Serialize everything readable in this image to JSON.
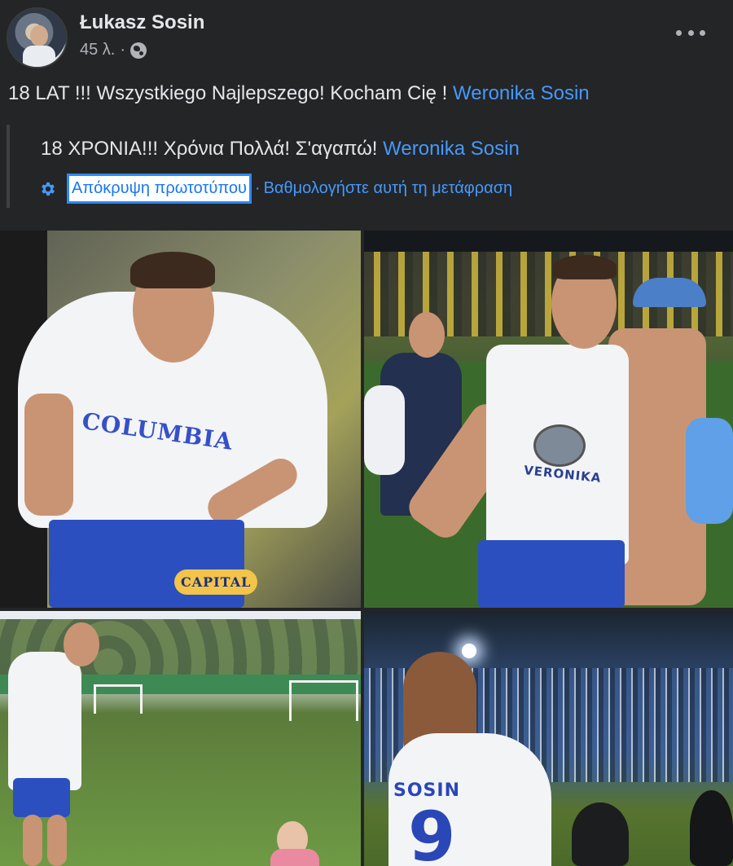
{
  "post": {
    "author": "Łukasz Sosin",
    "time": "45 λ.",
    "separator": "·",
    "message_text": "18 LAT !!! Wszystkiego Najlepszego! Kocham Cię !",
    "message_mention": "Weronika Sosin",
    "translation": {
      "text": "18 ΧΡΟΝΙΑ!!! Χρόνια Πολλά! Σ'αγαπώ!",
      "mention": "Weronika Sosin",
      "hide_original": "Απόκρυψη πρωτοτύπου",
      "separator": "·",
      "rate": "Βαθμολογήστε αυτή τη μετάφραση"
    }
  },
  "photos": {
    "p1_jersey": "COLUMBIA",
    "p1_shorts": "CAPITAL",
    "p2_shirt": "VERONIKA",
    "p4_jersey": "SOSIN",
    "p4_number": "9"
  },
  "colors": {
    "background": "#242526",
    "text": "#e4e6eb",
    "secondary": "#b0b3b8",
    "link": "#4599ff"
  },
  "icons": [
    "globe-icon",
    "more-options-icon",
    "gear-icon"
  ]
}
